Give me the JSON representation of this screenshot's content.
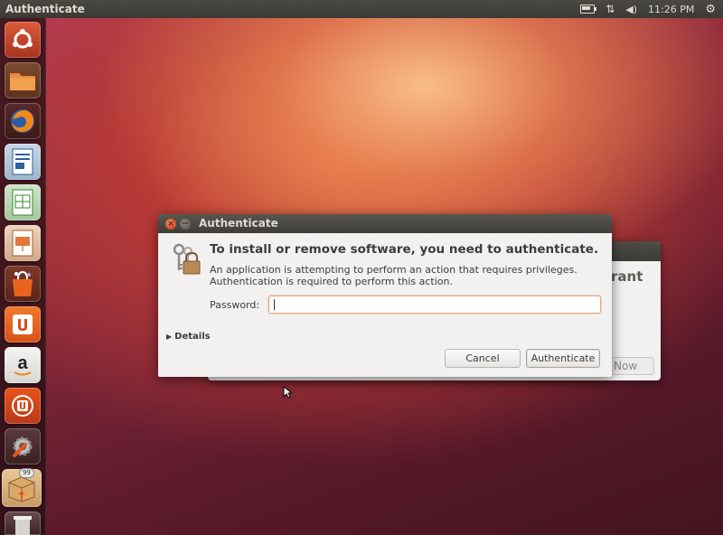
{
  "top_panel": {
    "app_title": "Authenticate",
    "clock": "11:26 PM",
    "tray_icons": [
      "battery-icon",
      "network-icon",
      "volume-icon",
      "settings-gear-icon"
    ]
  },
  "launcher": {
    "items": [
      {
        "name": "dash-home",
        "icon": "ubuntu-logo-icon"
      },
      {
        "name": "files",
        "icon": "folder-icon"
      },
      {
        "name": "firefox",
        "icon": "firefox-icon"
      },
      {
        "name": "libreoffice-writer",
        "icon": "writer-icon"
      },
      {
        "name": "libreoffice-calc",
        "icon": "calc-icon"
      },
      {
        "name": "libreoffice-impress",
        "icon": "impress-icon"
      },
      {
        "name": "software-center",
        "icon": "shopping-bag-icon"
      },
      {
        "name": "ubuntu-one",
        "icon": "ubuntu-one-icon"
      },
      {
        "name": "amazon",
        "icon": "amazon-icon"
      },
      {
        "name": "ubuntu-one-music",
        "icon": "ubuntu-one-music-icon"
      },
      {
        "name": "system-settings",
        "icon": "wrench-gear-icon"
      },
      {
        "name": "package-installer",
        "icon": "package-icon",
        "badge": "99"
      },
      {
        "name": "trash",
        "icon": "trash-icon"
      }
    ]
  },
  "back_dialog": {
    "partial_text": "rant",
    "partial_button": "Now"
  },
  "dialog": {
    "title": "Authenticate",
    "heading": "To install or remove software, you need to authenticate.",
    "description_line1": "An application is attempting to perform an action that requires privileges.",
    "description_line2": "Authentication is required to perform this action.",
    "password_label": "Password:",
    "password_value": "",
    "details_label": "Details",
    "cancel_label": "Cancel",
    "authenticate_label": "Authenticate"
  },
  "colors": {
    "accent_orange": "#dd4814",
    "panel_dark": "#3c3b37",
    "dialog_bg": "#f2f1f0"
  }
}
